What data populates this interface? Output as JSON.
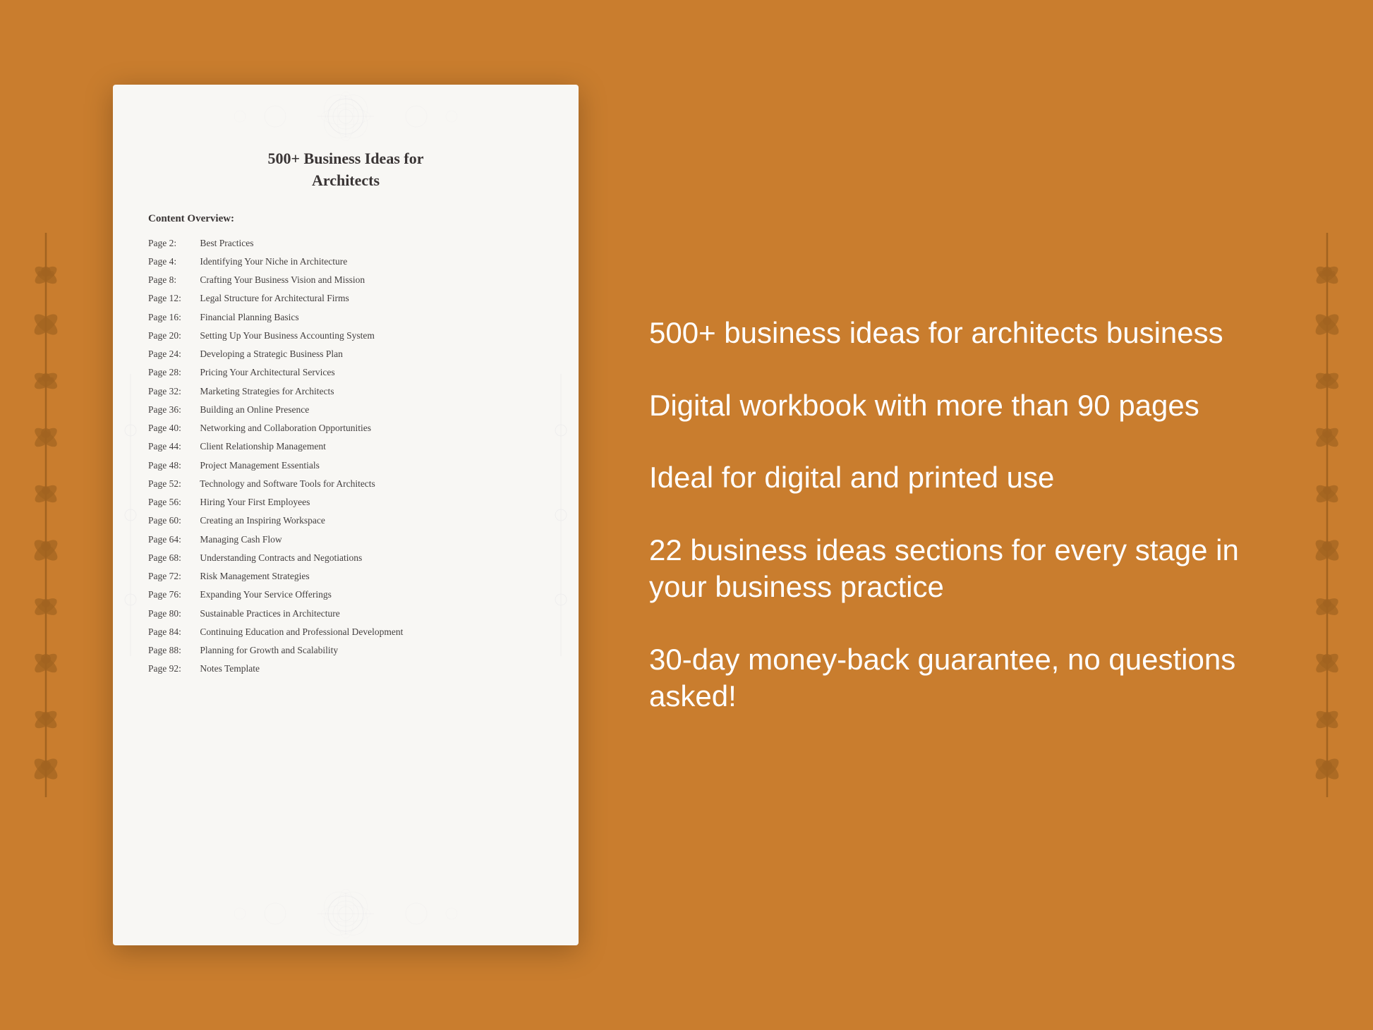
{
  "background": {
    "color": "#c97d2e"
  },
  "document": {
    "title_line1": "500+ Business Ideas for",
    "title_line2": "Architects",
    "section_header": "Content Overview:",
    "toc_items": [
      {
        "page": "Page  2:",
        "title": "Best Practices"
      },
      {
        "page": "Page  4:",
        "title": "Identifying Your Niche in Architecture"
      },
      {
        "page": "Page  8:",
        "title": "Crafting Your Business Vision and Mission"
      },
      {
        "page": "Page 12:",
        "title": "Legal Structure for Architectural Firms"
      },
      {
        "page": "Page 16:",
        "title": "Financial Planning Basics"
      },
      {
        "page": "Page 20:",
        "title": "Setting Up Your Business Accounting System"
      },
      {
        "page": "Page 24:",
        "title": "Developing a Strategic Business Plan"
      },
      {
        "page": "Page 28:",
        "title": "Pricing Your Architectural Services"
      },
      {
        "page": "Page 32:",
        "title": "Marketing Strategies for Architects"
      },
      {
        "page": "Page 36:",
        "title": "Building an Online Presence"
      },
      {
        "page": "Page 40:",
        "title": "Networking and Collaboration Opportunities"
      },
      {
        "page": "Page 44:",
        "title": "Client Relationship Management"
      },
      {
        "page": "Page 48:",
        "title": "Project Management Essentials"
      },
      {
        "page": "Page 52:",
        "title": "Technology and Software Tools for Architects"
      },
      {
        "page": "Page 56:",
        "title": "Hiring Your First Employees"
      },
      {
        "page": "Page 60:",
        "title": "Creating an Inspiring Workspace"
      },
      {
        "page": "Page 64:",
        "title": "Managing Cash Flow"
      },
      {
        "page": "Page 68:",
        "title": "Understanding Contracts and Negotiations"
      },
      {
        "page": "Page 72:",
        "title": "Risk Management Strategies"
      },
      {
        "page": "Page 76:",
        "title": "Expanding Your Service Offerings"
      },
      {
        "page": "Page 80:",
        "title": "Sustainable Practices in Architecture"
      },
      {
        "page": "Page 84:",
        "title": "Continuing Education and Professional Development"
      },
      {
        "page": "Page 88:",
        "title": "Planning for Growth and Scalability"
      },
      {
        "page": "Page 92:",
        "title": "Notes Template"
      }
    ]
  },
  "features": [
    "500+ business ideas for architects business",
    "Digital workbook with more than 90 pages",
    "Ideal for digital and printed use",
    "22 business ideas sections for every stage in your business practice",
    "30-day money-back guarantee, no questions asked!"
  ]
}
